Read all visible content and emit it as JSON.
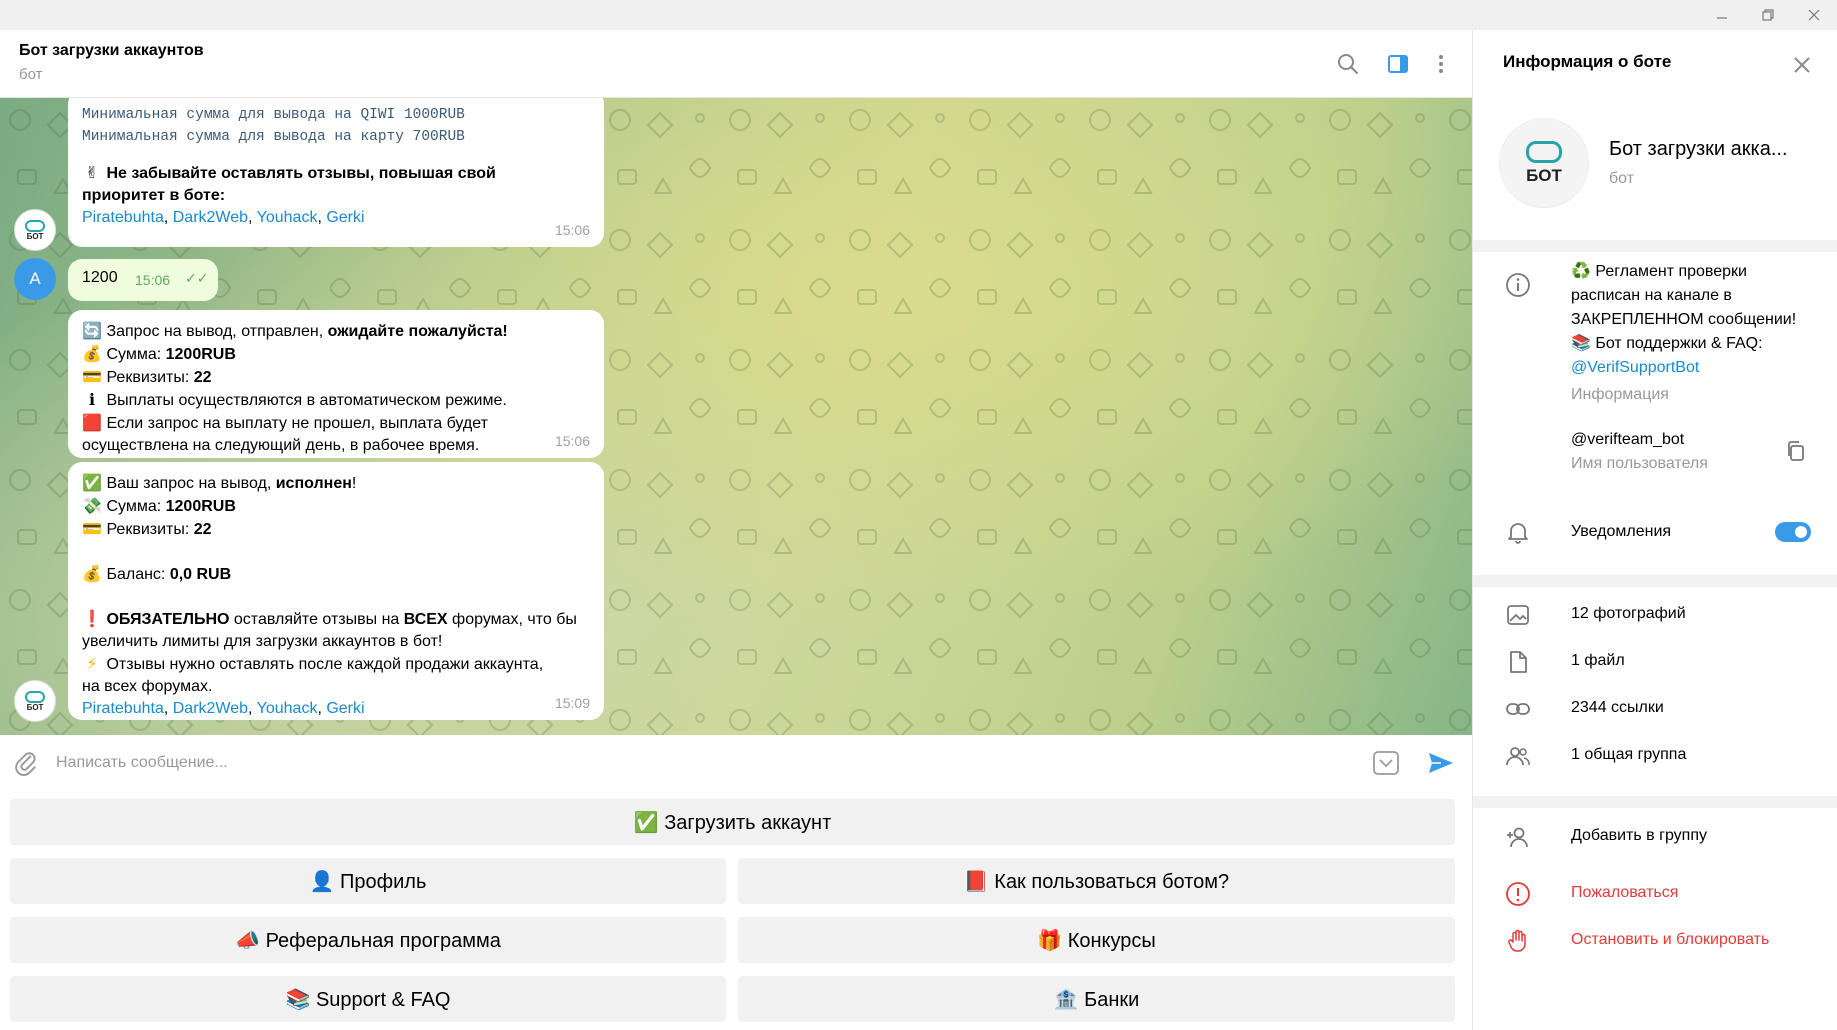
{
  "chat": {
    "title": "Бот загрузки аккаунтов",
    "subtitle": "бот",
    "messages": {
      "m1": {
        "mono1": "Минимальная сумма для вывода на QIWI 1000RUB",
        "mono2": "Минимальная сумма для вывода на карту 700RUB",
        "emoji": "✌",
        "text": "Не забывайте оставлять отзывы, повышая свой",
        "text2": "приоритет в боте:",
        "links": [
          "Piratebuhta",
          "Dark2Web",
          "Youhack",
          "Gerki"
        ],
        "time": "15:06"
      },
      "m2": {
        "avatar_letter": "A",
        "text": "1200",
        "time": "15:06",
        "ticks": "✓✓"
      },
      "m3": {
        "l1_emoji": "🔄",
        "l1a": "Запрос на вывод,  отправлен, ",
        "l1b": "ожидайте пожалуйста!",
        "l2_emoji": "💰",
        "l2a": "Сумма: ",
        "l2b": "1200RUB",
        "l3_emoji": "💳",
        "l3a": "Реквизиты: ",
        "l3b": "22",
        "l4_emoji": "ℹ",
        "l4": "Выплаты осуществляются в автоматическом режиме.",
        "l5_emoji": "🟥",
        "l5": "Если запрос на выплату не прошел, выплата будет",
        "l6": "осуществлена на следующий день, в рабочее время.",
        "time": "15:06"
      },
      "m4": {
        "l1_emoji": "✅",
        "l1a": "Ваш запрос на вывод, ",
        "l1b": "исполнен",
        "l1c": "!",
        "l2_emoji": "💸",
        "l2a": "Сумма: ",
        "l2b": "1200RUB",
        "l3_emoji": "💳",
        "l3a": "Реквизиты: ",
        "l3b": "22",
        "l4_emoji": "💰",
        "l4a": "Баланс: ",
        "l4b": "0,0 RUB",
        "l5_emoji": "❗",
        "l5a": "ОБЯЗАТЕЛЬНО",
        "l5b": " оставляйте отзывы на ",
        "l5c": "ВСЕХ",
        "l5d": " форумах, что бы",
        "l6": "увеличить лимиты для загрузки аккаунтов в бот!",
        "l7_emoji": "⚡",
        "l7": "Отзывы нужно оставлять после каждой продажи аккаунта,",
        "l8": "на всех форумах.",
        "links": [
          "Piratebuhta",
          "Dark2Web",
          "Youhack",
          "Gerki"
        ],
        "time": "15:09"
      }
    },
    "bot_avatar_text": "БОТ",
    "composer_placeholder": "Написать сообщение..."
  },
  "keyboard": {
    "upload": "✅ Загрузить аккаунт",
    "profile": "👤 Профиль",
    "howto": "📕 Как пользоваться ботом?",
    "referral": "📣 Реферальная программа",
    "contests": "🎁 Конкурсы",
    "support": "📚 Support & FAQ",
    "banks": "🏦 Банки"
  },
  "panel": {
    "title": "Информация о боте",
    "name": "Бот загрузки акка...",
    "sub": "бот",
    "avatar_text": "БОТ",
    "info_l1": "♻️ Регламент проверки",
    "info_l2": "расписан на канале в",
    "info_l3": "ЗАКРЕПЛЕННОМ сообщении!",
    "info_l4": "📚 Бот поддержки & FAQ:",
    "info_link": "@VerifSupportBot",
    "info_label": "Информация",
    "username": "@verifteam_bot",
    "username_label": "Имя пользователя",
    "notifications": "Уведомления",
    "notifications_on": true,
    "media": {
      "photos": "12 фотографий",
      "files": "1 файл",
      "links": "2344 ссылки",
      "groups": "1 общая группа"
    },
    "actions": {
      "add": "Добавить в группу",
      "report": "Пожаловаться",
      "block": "Остановить и блокировать"
    }
  },
  "colors": {
    "accent": "#3b9ae8",
    "link": "#168acd",
    "danger": "#e53935",
    "outgoing_bubble": "#effdde"
  }
}
